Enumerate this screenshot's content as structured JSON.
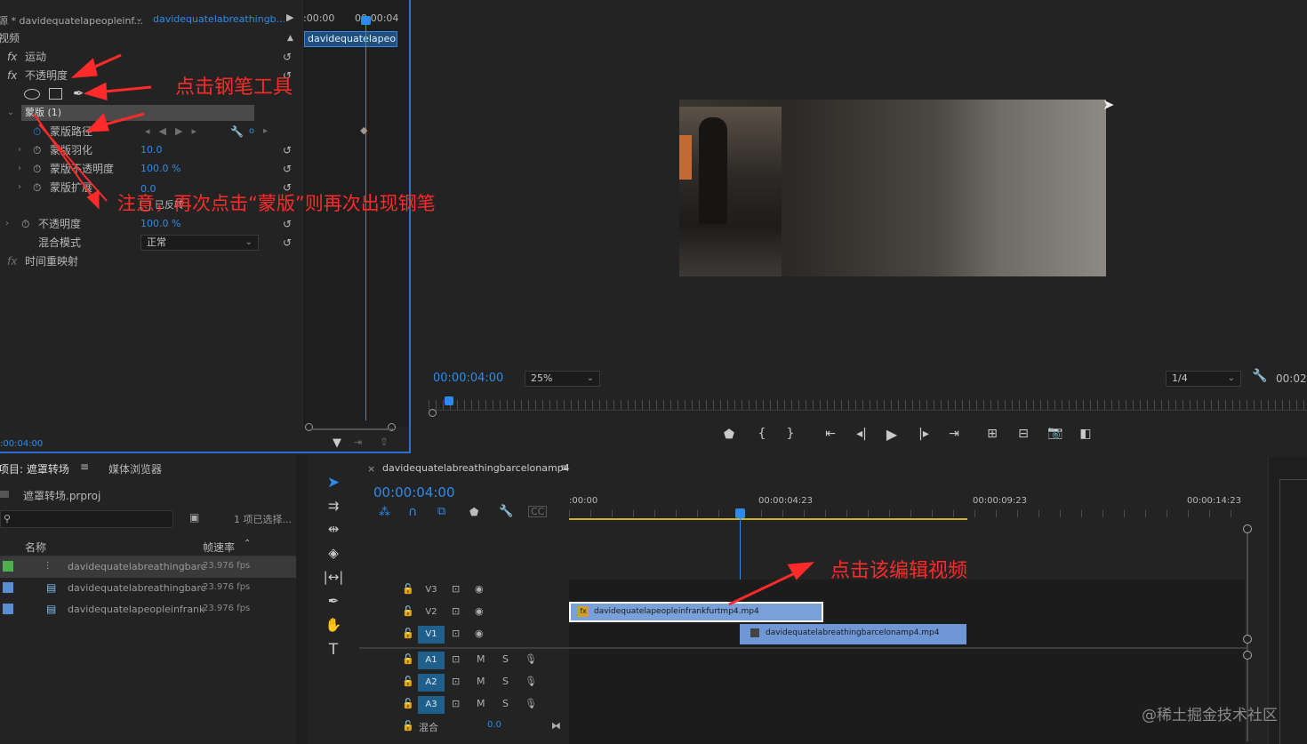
{
  "effect_controls": {
    "source_tab": "源 * davidequatelapeopleinf...",
    "sequence_tab": "davidequatelabreathingb...",
    "section_video": "视频",
    "motion": "运动",
    "opacity": "不透明度",
    "mask": "蒙版 (1)",
    "mask_path": "蒙版路径",
    "mask_feather": "蒙版羽化",
    "mask_feather_value": "10.0",
    "mask_opacity": "蒙版不透明度",
    "mask_opacity_value": "100.0 %",
    "mask_expansion": "蒙版扩展",
    "mask_expansion_value": "0.0",
    "inverted": "已反转",
    "opacity2": "不透明度",
    "opacity2_value": "100.0 %",
    "blend_mode": "混合模式",
    "blend_mode_value": "正常",
    "time_remap": "时间重映射",
    "mini_time_start": ":00:00",
    "mini_time_end": "00:00:04",
    "mini_clip": "davidequatelapeople",
    "bottom_time": ":00:04:00"
  },
  "program_monitor": {
    "timecode": "00:00:04:00",
    "zoom": "25%",
    "resolution": "1/4",
    "duration": "00:02"
  },
  "project": {
    "tab_project": "项目: 遮罩转场",
    "tab_media": "媒体浏览器",
    "file": "遮罩转场.prproj",
    "selected": "1 项已选择...",
    "col_name": "名称",
    "col_fps": "帧速率",
    "items": [
      {
        "name": "davidequatelabreathingbarc",
        "fps": "23.976 fps",
        "color": "#4caf50"
      },
      {
        "name": "davidequatelabreathingbarc",
        "fps": "23.976 fps",
        "color": "#5b8fd4"
      },
      {
        "name": "davidequatelapeopleinfrank",
        "fps": "23.976 fps",
        "color": "#5b8fd4"
      }
    ]
  },
  "timeline": {
    "sequence_name": "davidequatelabreathingbarcelonamp4",
    "timecode": "00:00:04:00",
    "ruler": [
      ":00:00",
      "00:00:04:23",
      "00:00:09:23",
      "00:00:14:23"
    ],
    "tracks": {
      "v3": "V3",
      "v2": "V2",
      "v1": "V1",
      "a1": "A1",
      "a2": "A2",
      "a3": "A3",
      "mix": "混合",
      "mix_value": "0.0",
      "m": "M",
      "s": "S"
    },
    "clip_v2": "davidequatelapeopleinfrankfurtmp4.mp4",
    "clip_v1": "davidequatelabreathingbarcelonamp4.mp4"
  },
  "annotations": {
    "pen_tool": "点击钢笔工具",
    "note": "注意，再次点击“蒙版”则再次出现钢笔",
    "click_clip": "点击该编辑视频"
  },
  "watermark": "@稀土掘金技术社区",
  "colors": {
    "accent": "#2d8ceb",
    "annotation": "#ff2a2a",
    "clip": "#6f97d6"
  }
}
